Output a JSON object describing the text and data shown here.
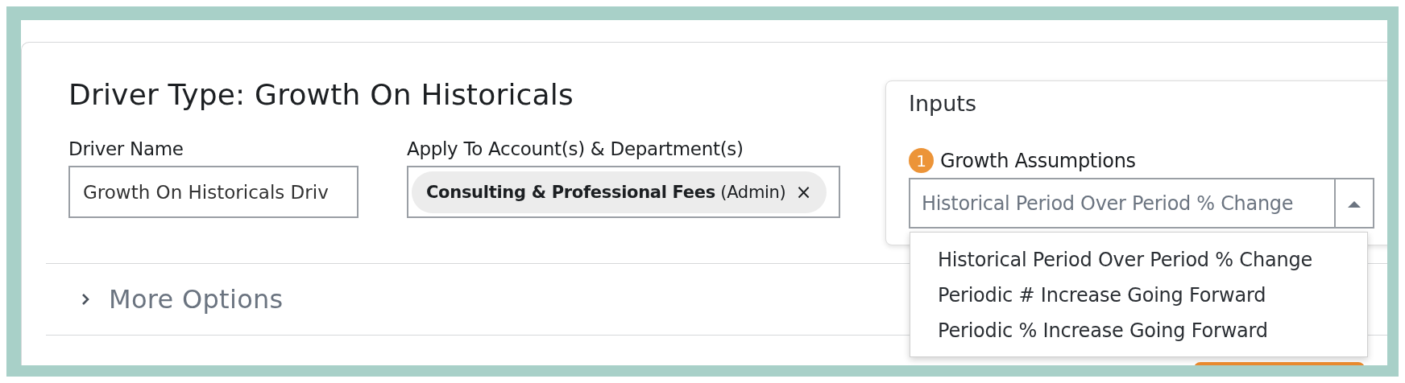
{
  "driver_type_title": "Driver Type: Growth On Historicals",
  "driver_name": {
    "label": "Driver Name",
    "value": "Growth On Historicals Driv"
  },
  "apply_to": {
    "label": "Apply To Account(s) & Department(s)",
    "tags": [
      {
        "name": "Consulting & Professional Fees",
        "detail": "(Admin)",
        "remove": "×"
      }
    ]
  },
  "more_options": {
    "label": "More Options",
    "expanded": false
  },
  "inputs_panel": {
    "title": "Inputs",
    "step": "1",
    "label": "Growth Assumptions",
    "value": "Historical Period Over Period % Change",
    "open": true,
    "options": [
      "Historical Period Over Period % Change",
      "Periodic # Increase Going Forward",
      "Periodic % Increase Going Forward"
    ]
  }
}
